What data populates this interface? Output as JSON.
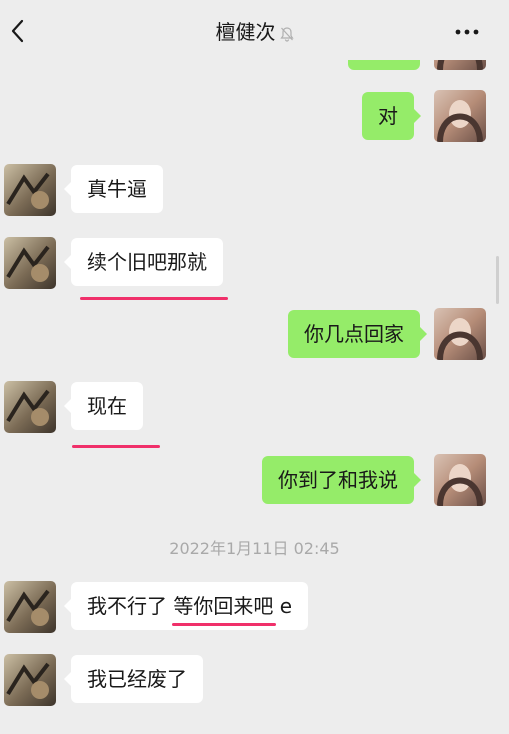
{
  "header": {
    "title": "檀健次",
    "back_icon": "chevron-left-icon",
    "mute_icon": "bell-muted-icon",
    "more_icon": "ellipsis-icon"
  },
  "messages": [
    {
      "side": "out",
      "text": "对"
    },
    {
      "side": "in",
      "text": "真牛逼"
    },
    {
      "side": "in",
      "text": "续个旧吧那就"
    },
    {
      "side": "out",
      "text": "你几点回家"
    },
    {
      "side": "in",
      "text": "现在"
    },
    {
      "side": "out",
      "text": "你到了和我说"
    },
    {
      "side": "in",
      "text_a": "我不行了 ",
      "text_b": "等你回来吧",
      "text_c": " e"
    },
    {
      "side": "in",
      "text": "我已经废了"
    }
  ],
  "timestamp": "2022年1月11日 02:45",
  "colors": {
    "background": "#ededed",
    "bubble_out": "#95ec69",
    "bubble_in": "#ffffff",
    "underline": "#f0306a"
  }
}
